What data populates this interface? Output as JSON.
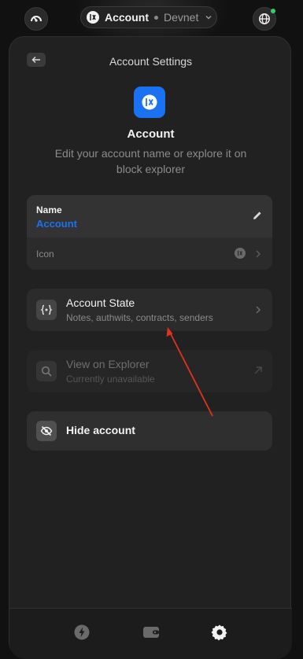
{
  "topbar": {
    "account_name": "Account",
    "network_name": "Devnet"
  },
  "panel": {
    "title": "Account Settings",
    "account_title": "Account",
    "description": "Edit your account name or explore it on block explorer"
  },
  "name_card": {
    "label": "Name",
    "value": "Account",
    "icon_label": "Icon"
  },
  "rows": {
    "account_state": {
      "title": "Account State",
      "subtitle": "Notes, authwits, contracts, senders"
    },
    "explorer": {
      "title": "View on Explorer",
      "subtitle": "Currently unavailable"
    },
    "hide": {
      "title": "Hide account"
    }
  },
  "colors": {
    "accent": "#1a72f2",
    "background": "#111111",
    "panel": "#212121",
    "status_online": "#2fd06b",
    "annotation_arrow": "#e0321f"
  },
  "icons": {
    "top_left": "speedometer-icon",
    "top_right": "globe-icon",
    "nav": [
      "lightning-icon",
      "wallet-icon",
      "gear-icon"
    ]
  }
}
